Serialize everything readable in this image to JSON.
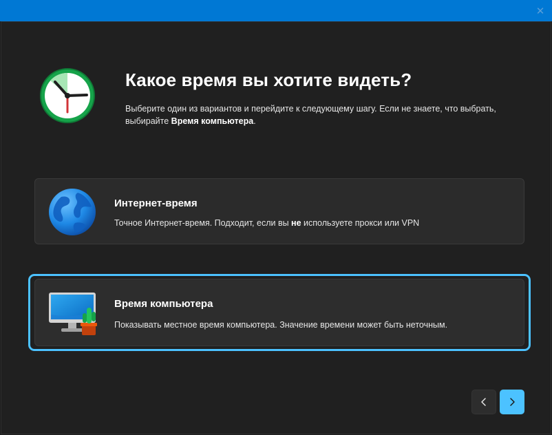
{
  "window": {
    "close_glyph": "✕"
  },
  "header": {
    "title": "Какое время вы хотите видеть?",
    "description_part1": "Выберите один из вариантов и перейдите к следующему шагу. Если не знаете, что выбрать, выбирайте ",
    "description_bold": "Время компьютера",
    "description_part2": "."
  },
  "options": [
    {
      "title": "Интернет-время",
      "desc_part1": "Точное Интернет-время. Подходит, если вы ",
      "desc_bold": "не",
      "desc_part2": " используете прокси или VPN",
      "icon": "globe-icon",
      "selected": false
    },
    {
      "title": "Время компьютера",
      "desc": "Показывать местное время компьютера. Значение времени может быть неточным.",
      "icon": "computer-icon",
      "selected": true
    }
  ],
  "navigation": {
    "back_icon": "chevron-left-icon",
    "next_icon": "chevron-right-icon"
  },
  "colors": {
    "titlebar": "#0078d4",
    "accent": "#4cc2ff",
    "background": "#202020",
    "card": "#2b2b2b"
  }
}
